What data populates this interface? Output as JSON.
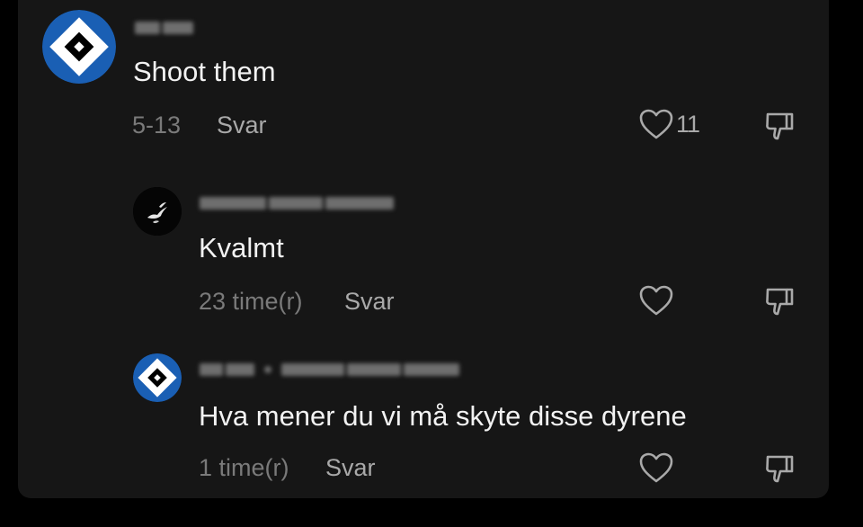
{
  "comments": [
    {
      "author": "",
      "text": "Shoot them",
      "date": "5-13",
      "reply_label": "Svar",
      "like_count": "11",
      "avatar_icon": "hsv-diamond-logo"
    },
    {
      "author": "",
      "text": "Kvalmt",
      "date": "23 time(r)",
      "reply_label": "Svar",
      "like_count": "",
      "avatar_icon": "white-dove-on-black"
    },
    {
      "author": "",
      "text": "Hva mener du vi må skyte disse dyrene",
      "date": "1 time(r)",
      "reply_label": "Svar",
      "like_count": "",
      "avatar_icon": "hsv-diamond-logo"
    }
  ],
  "colors": {
    "background": "#000000",
    "panel": "#161616",
    "text": "#f2f2f2",
    "meta": "#7a7a7a",
    "action": "#a9a9a9",
    "logo_blue": "#1a5fb4"
  }
}
